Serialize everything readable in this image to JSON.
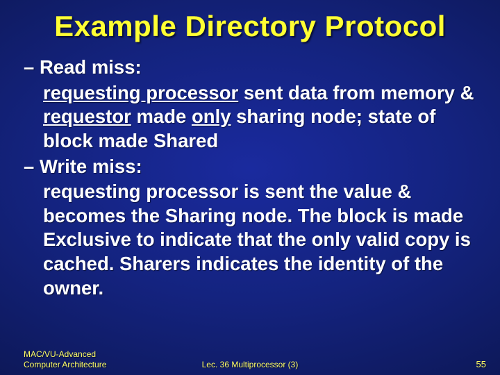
{
  "title": "Example Directory Protocol",
  "items": [
    {
      "label": "Read miss:",
      "sub_parts": [
        {
          "t": "requesting processor",
          "u": true
        },
        {
          "t": " sent data from memory & ",
          "u": false
        },
        {
          "t": "requestor",
          "u": true
        },
        {
          "t": " made ",
          "u": false
        },
        {
          "t": "only",
          "u": true
        },
        {
          "t": " sharing node; state of block made Shared",
          "u": false
        }
      ]
    },
    {
      "label": "Write miss:",
      "sub_parts": [
        {
          "t": "requesting processor is sent the value & becomes the Sharing node. The block is made Exclusive to indicate that the only valid copy is cached. Sharers indicates the identity of the owner.",
          "u": false
        }
      ]
    }
  ],
  "footer": {
    "left_line1": "MAC/VU-Advanced",
    "left_line2": "Computer Architecture",
    "center": "Lec. 36 Multiprocessor (3)",
    "right": "55"
  }
}
